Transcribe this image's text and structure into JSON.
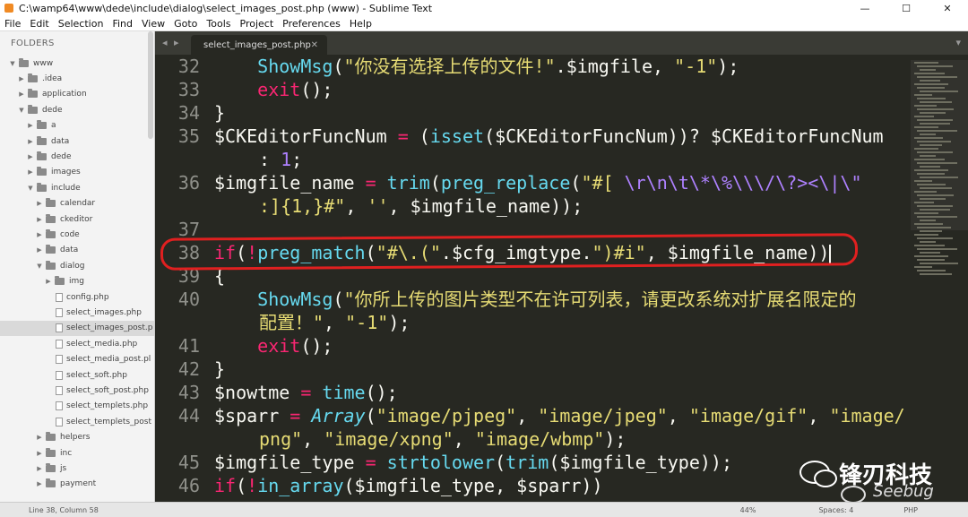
{
  "window": {
    "title": "C:\\wamp64\\www\\dede\\include\\dialog\\select_images_post.php (www) - Sublime Text",
    "minimize": "—",
    "maximize": "☐",
    "close": "✕"
  },
  "menu": [
    "File",
    "Edit",
    "Selection",
    "Find",
    "View",
    "Goto",
    "Tools",
    "Project",
    "Preferences",
    "Help"
  ],
  "sidebar": {
    "header": "FOLDERS",
    "items": [
      {
        "label": "www",
        "type": "folder",
        "open": true,
        "depth": 0
      },
      {
        "label": ".idea",
        "type": "folder",
        "open": false,
        "depth": 1
      },
      {
        "label": "application",
        "type": "folder",
        "open": false,
        "depth": 1
      },
      {
        "label": "dede",
        "type": "folder",
        "open": true,
        "depth": 1
      },
      {
        "label": "a",
        "type": "folder",
        "open": false,
        "depth": 2
      },
      {
        "label": "data",
        "type": "folder",
        "open": false,
        "depth": 2
      },
      {
        "label": "dede",
        "type": "folder",
        "open": false,
        "depth": 2
      },
      {
        "label": "images",
        "type": "folder",
        "open": false,
        "depth": 2
      },
      {
        "label": "include",
        "type": "folder",
        "open": true,
        "depth": 2
      },
      {
        "label": "calendar",
        "type": "folder",
        "open": false,
        "depth": 3
      },
      {
        "label": "ckeditor",
        "type": "folder",
        "open": false,
        "depth": 3
      },
      {
        "label": "code",
        "type": "folder",
        "open": false,
        "depth": 3
      },
      {
        "label": "data",
        "type": "folder",
        "open": false,
        "depth": 3
      },
      {
        "label": "dialog",
        "type": "folder",
        "open": true,
        "depth": 3
      },
      {
        "label": "img",
        "type": "folder",
        "open": false,
        "depth": 4
      },
      {
        "label": "config.php",
        "type": "file",
        "depth": 4
      },
      {
        "label": "select_images.php",
        "type": "file",
        "depth": 4
      },
      {
        "label": "select_images_post.p",
        "type": "file",
        "depth": 4,
        "selected": true
      },
      {
        "label": "select_media.php",
        "type": "file",
        "depth": 4
      },
      {
        "label": "select_media_post.pl",
        "type": "file",
        "depth": 4
      },
      {
        "label": "select_soft.php",
        "type": "file",
        "depth": 4
      },
      {
        "label": "select_soft_post.php",
        "type": "file",
        "depth": 4
      },
      {
        "label": "select_templets.php",
        "type": "file",
        "depth": 4
      },
      {
        "label": "select_templets_post",
        "type": "file",
        "depth": 4
      },
      {
        "label": "helpers",
        "type": "folder",
        "open": false,
        "depth": 3
      },
      {
        "label": "inc",
        "type": "folder",
        "open": false,
        "depth": 3
      },
      {
        "label": "js",
        "type": "folder",
        "open": false,
        "depth": 3
      },
      {
        "label": "payment",
        "type": "folder",
        "open": false,
        "depth": 3
      }
    ]
  },
  "tab": {
    "label": "select_images_post.php",
    "close": "✕",
    "nav": "◂ ▸",
    "dropdown": "▾"
  },
  "line_numbers": [
    "32",
    "33",
    "34",
    "35",
    "36",
    "37",
    "38",
    "39",
    "40",
    "41",
    "42",
    "43",
    "44",
    "45",
    "46"
  ],
  "status": {
    "position": "Line 38, Column 58",
    "zoom": "44%",
    "spaces": "Spaces: 4",
    "syntax": "PHP"
  },
  "watermark": {
    "cn": "锋刃科技",
    "en": "Seebug"
  },
  "colors": {
    "background": "#272822",
    "keyword": "#f92672",
    "function": "#66d9ef",
    "string": "#e6db74",
    "number": "#ae81ff",
    "highlight": "#e02020"
  }
}
